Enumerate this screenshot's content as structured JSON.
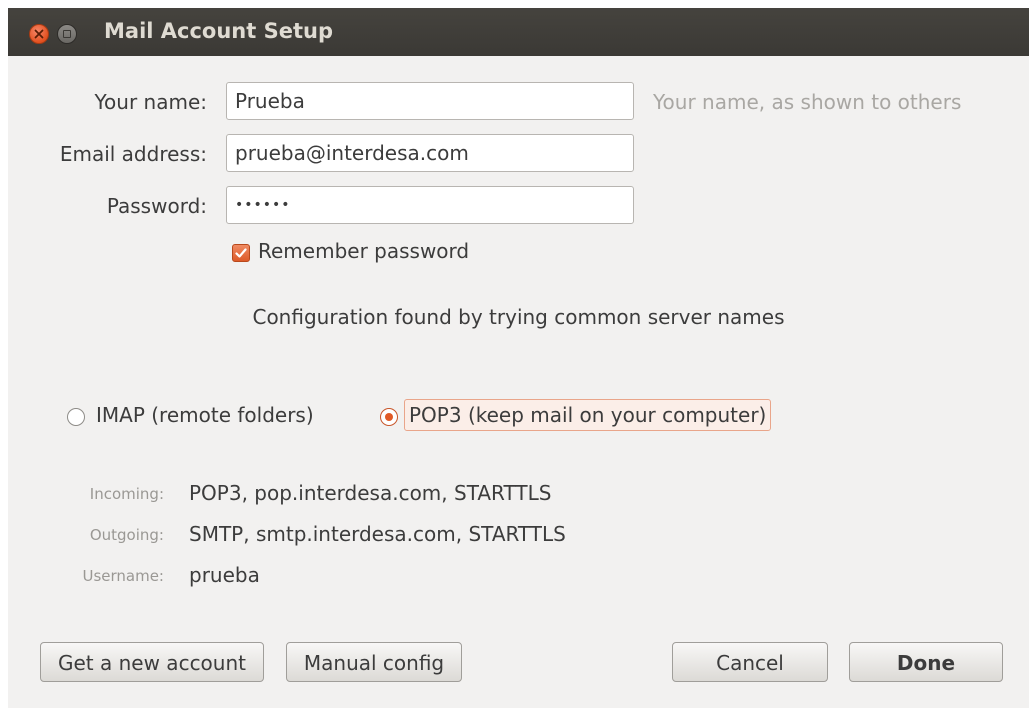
{
  "window": {
    "title": "Mail Account Setup"
  },
  "form": {
    "name_label": "Your name:",
    "name_value": "Prueba",
    "name_hint": "Your name, as shown to others",
    "email_label": "Email address:",
    "email_value": "prueba@interdesa.com",
    "password_label": "Password:",
    "password_value": "••••••",
    "remember_label": "Remember password",
    "remember_checked": true
  },
  "status": {
    "message": "Configuration found by trying common server names"
  },
  "protocol": {
    "imap_label": "IMAP (remote folders)",
    "pop3_label": "POP3 (keep mail on your computer)",
    "selected": "POP3"
  },
  "details": {
    "incoming_label": "Incoming:",
    "incoming_value": "POP3, pop.interdesa.com, STARTTLS",
    "outgoing_label": "Outgoing:",
    "outgoing_value": "SMTP, smtp.interdesa.com, STARTTLS",
    "username_label": "Username:",
    "username_value": "prueba"
  },
  "buttons": {
    "new_account": "Get a new account",
    "manual_config": "Manual config",
    "cancel": "Cancel",
    "done": "Done"
  },
  "colors": {
    "accent": "#dd4814",
    "titlebar": "#3f3d39",
    "background": "#f2f1f0"
  }
}
